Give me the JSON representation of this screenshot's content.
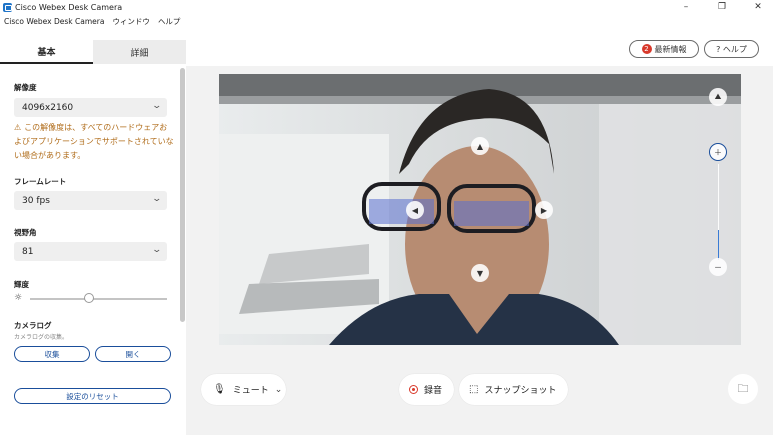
{
  "window": {
    "title": "Cisco Webex Desk Camera",
    "controls": [
      "–",
      "❐",
      "✕"
    ]
  },
  "menu": [
    "Cisco Webex Desk Camera",
    "ウィンドウ",
    "ヘルプ"
  ],
  "tabs": {
    "basic": "基本",
    "detail": "詳細"
  },
  "settings": {
    "resolution": {
      "label": "解像度",
      "value": "4096x2160"
    },
    "warning": "この解像度は、すべてのハードウェアおよびアプリケーションでサポートされていない場合があります。",
    "framerate": {
      "label": "フレームレート",
      "value": "30 fps"
    },
    "fov": {
      "label": "視野角",
      "value": "81"
    },
    "brightness": {
      "label": "輝度",
      "level": 0.44
    },
    "camera_log": {
      "label": "カメラログ",
      "sublabel": "カメラログの収集。",
      "collect_label": "収集",
      "open_label": "開く"
    },
    "reset_label": "設定のリセット"
  },
  "header_buttons": {
    "updates_label": "最新情報",
    "updates_badge": "2",
    "help_label": "? ヘルプ"
  },
  "controls": {
    "mute_label": "ミュート",
    "record_label": "録音",
    "snapshot_label": "スナップショット"
  },
  "colors": {
    "accent_blue": "#1a4e9b",
    "warning_orange": "#b06c1a",
    "record_red": "#d8392b"
  }
}
